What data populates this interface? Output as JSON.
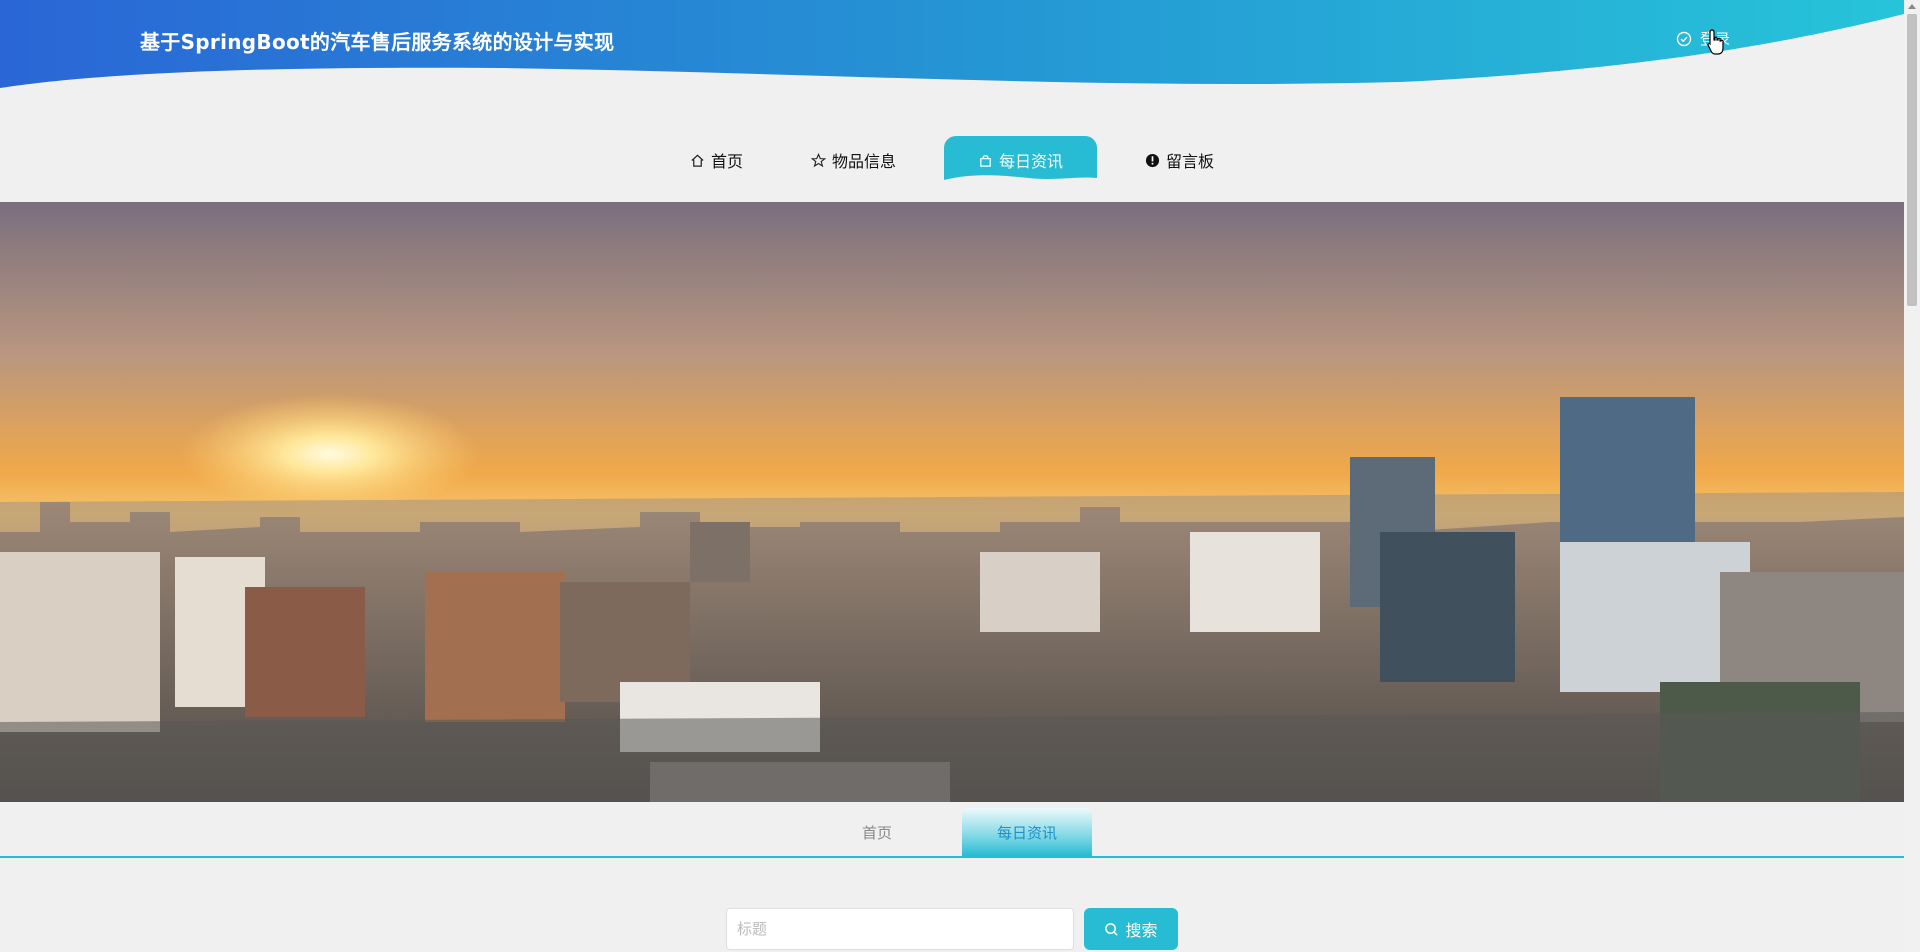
{
  "header": {
    "title": "基于SpringBoot的汽车售后服务系统的设计与实现",
    "login_label": "登录",
    "gradient_start": "#2a6fd4",
    "gradient_end": "#27c3d8"
  },
  "nav": {
    "items": [
      {
        "label": "首页",
        "icon": "home-icon"
      },
      {
        "label": "物品信息",
        "icon": "star-icon"
      },
      {
        "label": "每日资讯",
        "icon": "bag-icon",
        "active": true
      },
      {
        "label": "留言板",
        "icon": "alert-circle-icon"
      }
    ]
  },
  "banner": {
    "image": "city skyline at sunset"
  },
  "breadcrumb": {
    "items": [
      {
        "label": "首页"
      },
      {
        "label": "每日资讯",
        "active": true
      }
    ]
  },
  "search": {
    "placeholder": "标题",
    "button_label": "搜索"
  },
  "colors": {
    "accent": "#27bcd3",
    "background": "#f0f0f0"
  }
}
